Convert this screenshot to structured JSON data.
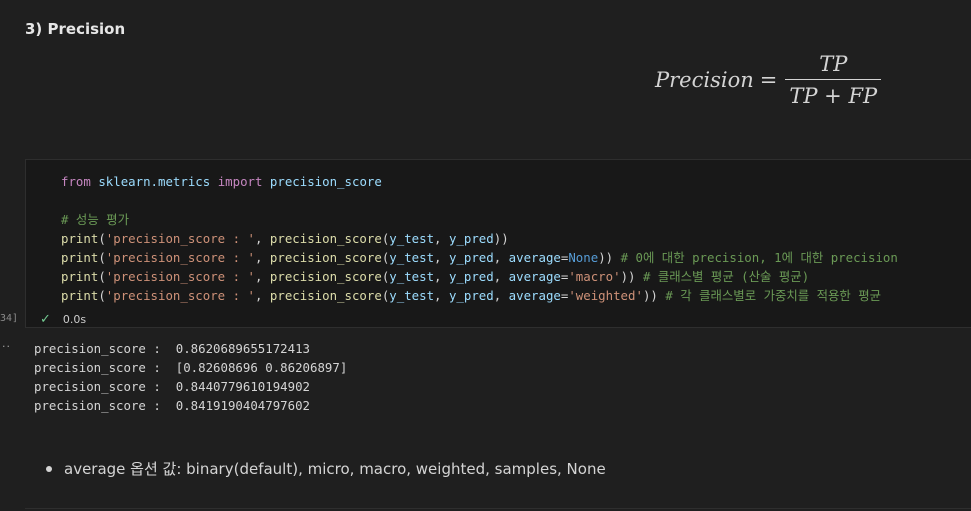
{
  "markdown": {
    "heading": "3) Precision",
    "formula": {
      "lhs": "Precision",
      "eq": "=",
      "numerator": "TP",
      "denominator": "TP + FP"
    },
    "bullet": "average 옵션 값: binary(default), micro, macro, weighted, samples, None"
  },
  "code_cell": {
    "execution_count": "34]",
    "status_time": "0.0s",
    "lines": {
      "l1": {
        "kw1": "from",
        "mod": "sklearn.metrics",
        "kw2": "import",
        "name": "precision_score"
      },
      "l2": {
        "comment": "# 성능 평가"
      },
      "l3": {
        "fn": "print",
        "p1": "(",
        "str": "'precision_score : '",
        "p2": ", ",
        "fn2": "precision_score",
        "p3": "(",
        "a1": "y_test",
        "p4": ", ",
        "a2": "y_pred",
        "p5": "))"
      },
      "l4": {
        "fn": "print",
        "p1": "(",
        "str": "'precision_score : '",
        "p2": ", ",
        "fn2": "precision_score",
        "p3": "(",
        "a1": "y_test",
        "p4": ", ",
        "a2": "y_pred",
        "p5": ", ",
        "kwarg": "average",
        "eq": "=",
        "val": "None",
        "p6": "))",
        "comment": " # 0에 대한 precision, 1에 대한 precision"
      },
      "l5": {
        "fn": "print",
        "p1": "(",
        "str": "'precision_score : '",
        "p2": ", ",
        "fn2": "precision_score",
        "p3": "(",
        "a1": "y_test",
        "p4": ", ",
        "a2": "y_pred",
        "p5": ", ",
        "kwarg": "average",
        "eq": "=",
        "val": "'macro'",
        "p6": "))",
        "comment": " # 클래스별 평균 (산술 평균)"
      },
      "l6": {
        "fn": "print",
        "p1": "(",
        "str": "'precision_score : '",
        "p2": ", ",
        "fn2": "precision_score",
        "p3": "(",
        "a1": "y_test",
        "p4": ", ",
        "a2": "y_pred",
        "p5": ", ",
        "kwarg": "average",
        "eq": "=",
        "val": "'weighted'",
        "p6": "))",
        "comment": " # 각 클래스별로 가중치를 적용한 평균"
      }
    }
  },
  "output": {
    "dots": "··",
    "lines": [
      "precision_score :  0.8620689655172413",
      "precision_score :  [0.82608696 0.86206897]",
      "precision_score :  0.8440779610194902",
      "precision_score :  0.8419190404797602"
    ]
  },
  "colors": {
    "background": "#1f1f1f",
    "cell_background": "#181818",
    "keyword": "#c586c0",
    "function": "#dcdcaa",
    "string": "#ce9178",
    "comment": "#6a9955",
    "variable": "#9cdcfe",
    "constant": "#569cd6",
    "success_check": "#73c991"
  },
  "icons": {
    "status": "check-icon"
  }
}
